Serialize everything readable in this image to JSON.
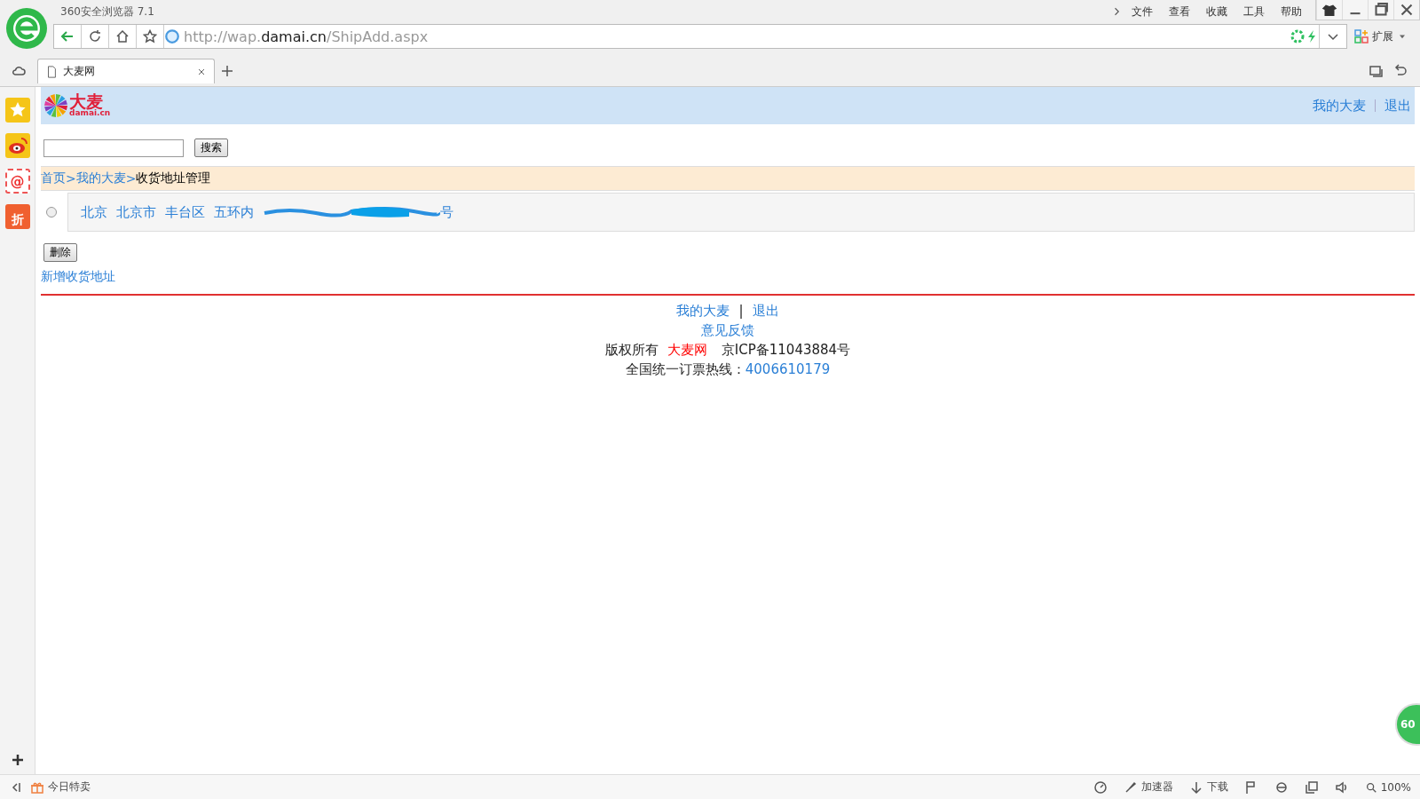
{
  "browser": {
    "title": "360安全浏览器 7.1",
    "menu": [
      "文件",
      "查看",
      "收藏",
      "工具",
      "帮助"
    ],
    "url": {
      "prefix": "http://wap.",
      "domain": "damai.cn",
      "path": "/ShipAdd.aspx"
    },
    "extension_label": "扩展",
    "tabs": [
      {
        "label": "大麦网",
        "selected": true
      }
    ],
    "sidebar": [
      {
        "kind": "star"
      },
      {
        "kind": "weibo"
      },
      {
        "kind": "mail",
        "glyph": "@"
      },
      {
        "kind": "sale",
        "glyph": "折"
      }
    ]
  },
  "page": {
    "logo": {
      "name": "大麦",
      "domain": "damai.cn"
    },
    "header_links": [
      "我的大麦",
      "退出"
    ],
    "search": {
      "button": "搜索"
    },
    "breadcrumb": [
      {
        "label": "首页",
        "kind": "link"
      },
      {
        "label": ">",
        "kind": "separator"
      },
      {
        "label": "我的大麦",
        "kind": "link"
      },
      {
        "label": ">",
        "kind": "separator"
      },
      {
        "label": "收货地址管理",
        "kind": "current"
      }
    ],
    "addresses": [
      {
        "parts": [
          "北京",
          "北京市",
          "丰台区",
          "五环内"
        ],
        "redacted": true,
        "tail": "号",
        "selected": false
      }
    ],
    "delete_button": "删除",
    "add_link": "新增收货地址",
    "footer": {
      "links": [
        "我的大麦",
        "退出"
      ],
      "separator": "|",
      "feedback": "意见反馈",
      "copyright": "版权所有",
      "brand": "大麦网",
      "icp": "京ICP备11043884号",
      "hotline_label": "全国统一订票热线：",
      "hotline": "4006610179"
    }
  },
  "floating_badge": "60",
  "status_bar": {
    "left": "今日特卖",
    "accelerator": "加速器",
    "download": "下载",
    "zoom": "100%"
  }
}
